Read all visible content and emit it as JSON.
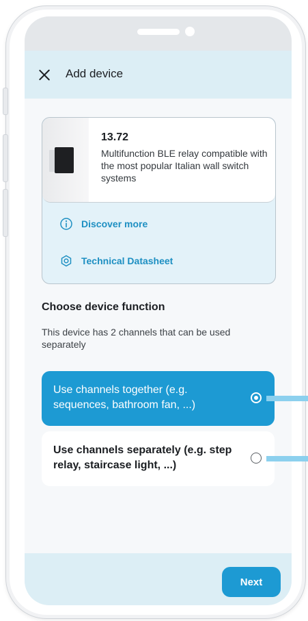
{
  "app_bar": {
    "title": "Add device",
    "close_icon": "close-icon"
  },
  "product": {
    "name": "13.72",
    "description": "Multifunction BLE relay compatible with the most popular Italian wall switch systems",
    "links": [
      {
        "label": "Discover more",
        "icon": "info-icon"
      },
      {
        "label": "Technical Datasheet",
        "icon": "datasheet-icon"
      }
    ]
  },
  "function_section": {
    "title": "Choose device function",
    "subtitle": "This device has 2 channels that can be used separately",
    "options": [
      {
        "label": "Use channels together (e.g. sequences, bathroom fan, ...)",
        "selected": true
      },
      {
        "label": "Use channels separately (e.g. step relay, staircase light, ...)",
        "selected": false
      }
    ]
  },
  "footer": {
    "next_label": "Next"
  },
  "colors": {
    "accent": "#1d9ad3",
    "appbar_bg": "#dceef5",
    "link": "#1d8fc2"
  }
}
